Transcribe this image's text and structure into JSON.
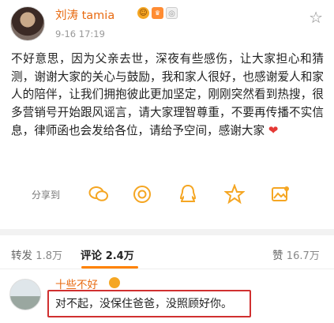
{
  "post": {
    "username": "刘涛 tamia",
    "timestamp": "9-16 17:19",
    "body": "不好意思，因为父亲去世，深夜有些感伤，让大家担心和猜测，谢谢大家的关心与鼓励，我和家人很好，也感谢爱人和家人的陪伴，让我们拥抱彼此更加坚定，刚刚突然看到热搜，很多营销号开始跟风谣言，请大家理智尊重，不要再传播不实信息，律师函也会发给各位，请给予空间，感谢大家",
    "heart_glyph": "❤"
  },
  "share": {
    "label": "分享到",
    "icons": [
      "wechat-icon",
      "moments-icon",
      "qq-icon",
      "qzone-icon",
      "image-share-icon"
    ]
  },
  "tabs": {
    "repost_label": "转发",
    "repost_count": "1.8万",
    "comment_label": "评论",
    "comment_count": "2.4万",
    "like_label": "赞",
    "like_count": "16.7万"
  },
  "comment": {
    "name": "十些不好",
    "text": "对不起，没保住爸爸，没照顾好你。"
  },
  "colors": {
    "accent": "#ff8200",
    "username": "#e86a10",
    "highlight_box": "#d03030"
  }
}
